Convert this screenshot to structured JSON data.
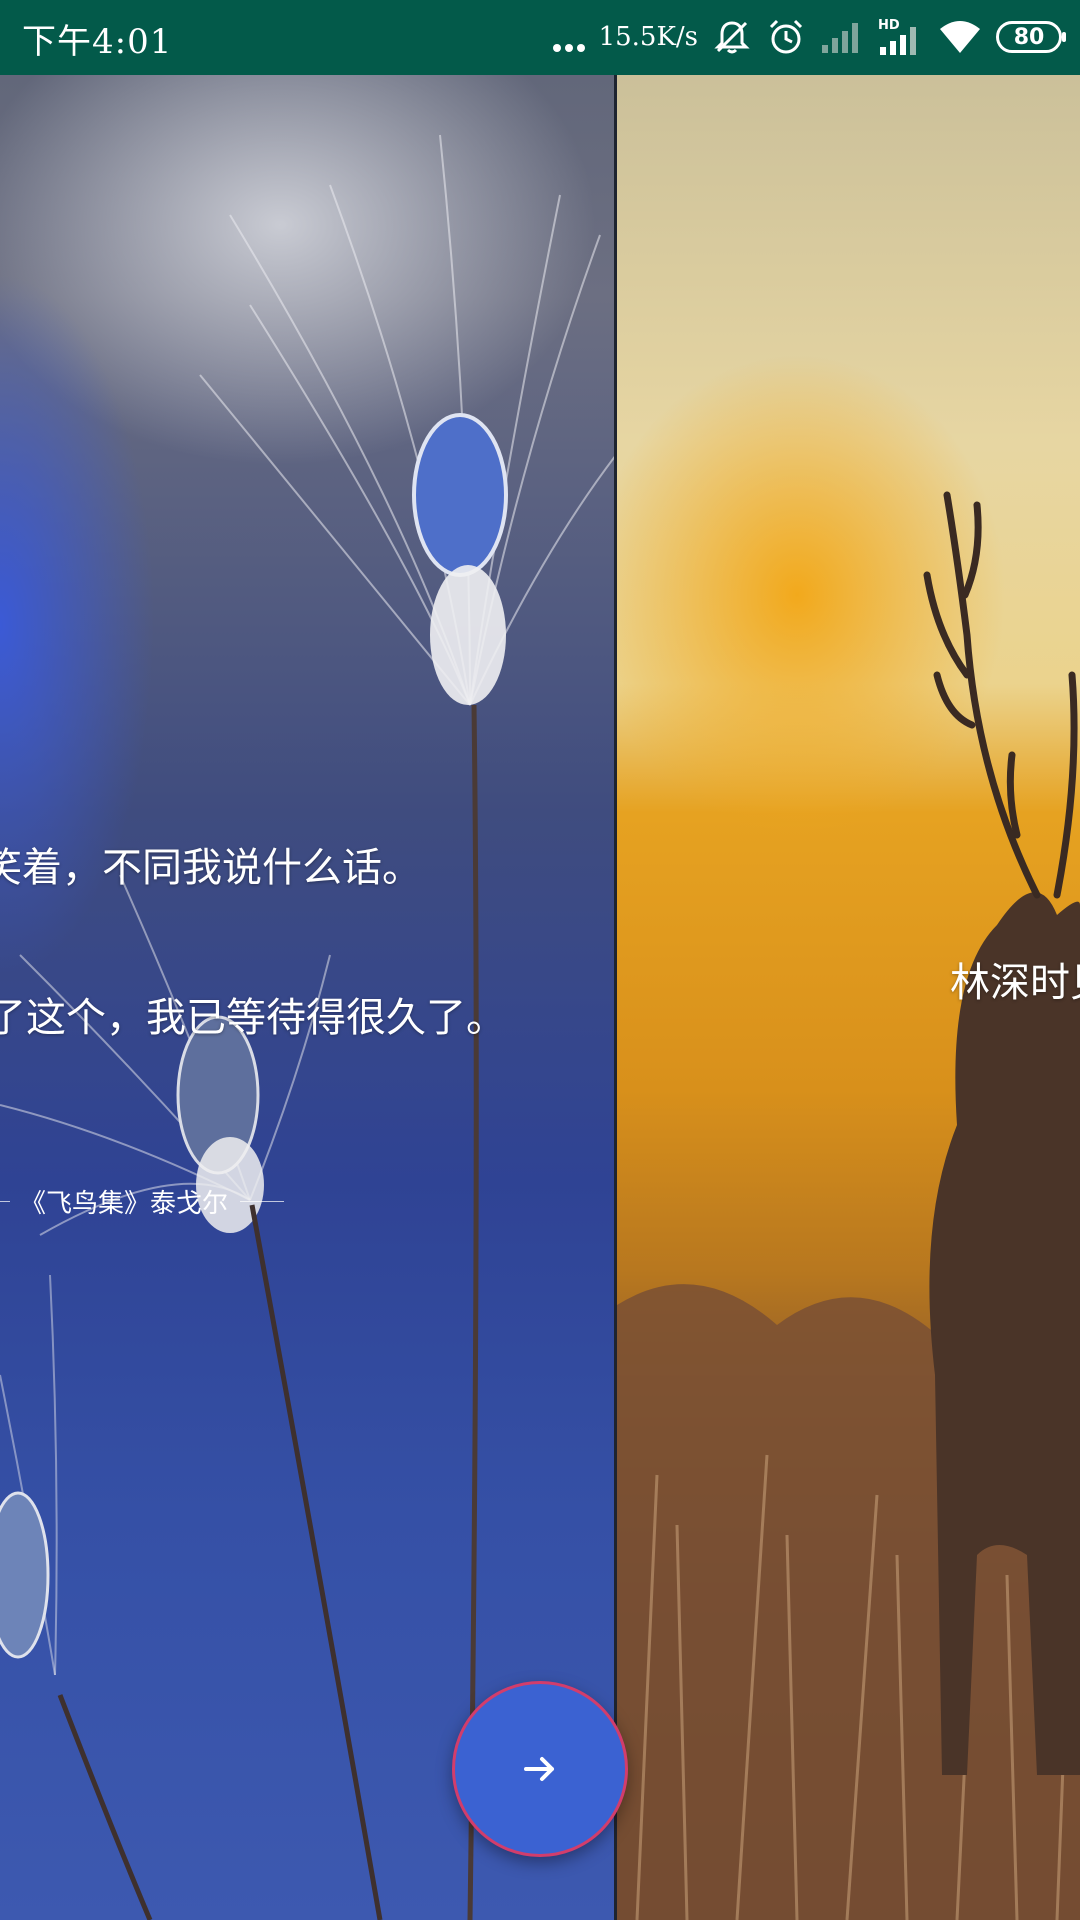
{
  "status_bar": {
    "time": "下午4:01",
    "network_speed": "15.5K/s",
    "battery_level": "80",
    "icons": [
      "more-dots-icon",
      "mute-bell-icon",
      "alarm-clock-icon",
      "signal-empty-icon",
      "hd-signal-icon",
      "wifi-icon",
      "battery-icon"
    ]
  },
  "pages": {
    "left": {
      "quote_lines": [
        "笑着，不同我说什么话。",
        "了这个，我已等待得很久了。"
      ],
      "attribution": "《飞鸟集》泰戈尔",
      "background_colors": [
        "#62677a",
        "#2f4394",
        "#3d59b0"
      ]
    },
    "right": {
      "title": "林深时见鹿，",
      "background_colors": [
        "#e7d6a2",
        "#e6a221",
        "#55392a"
      ]
    }
  },
  "fab": {
    "icon": "arrow-right-icon",
    "color": "#3b62d2",
    "border_color": "#d23d6c"
  }
}
